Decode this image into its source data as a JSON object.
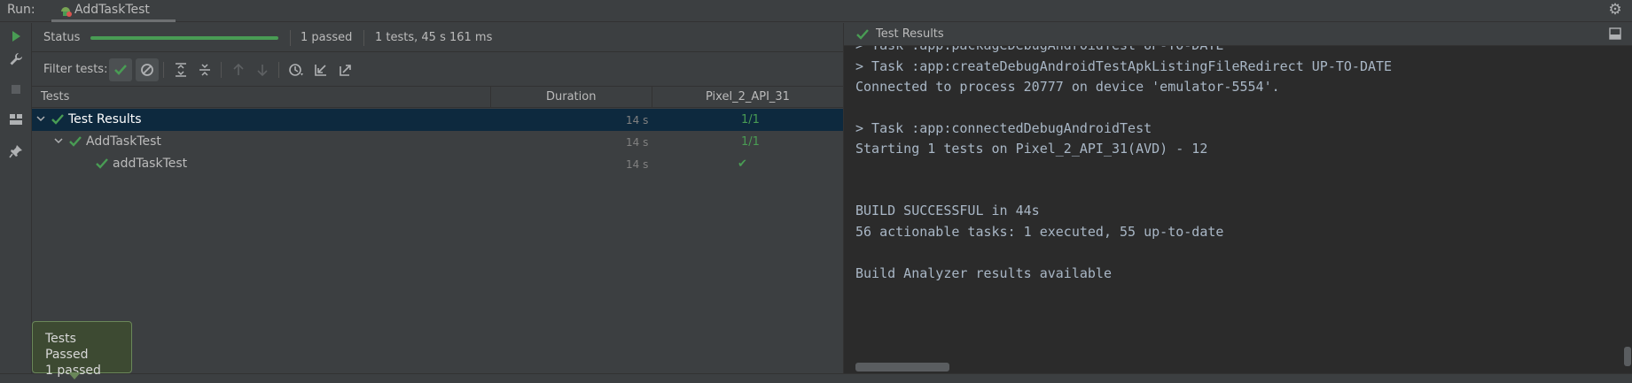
{
  "run_bar": {
    "label": "Run:",
    "tab_label": "AddTaskTest",
    "tab_icon": "android-test-icon",
    "settings_icon": "gear-icon"
  },
  "tool_strip": {
    "icons": [
      "run-icon",
      "wrench-icon",
      "stop-icon",
      "layout-icon",
      "pin-icon"
    ]
  },
  "status": {
    "label": "Status",
    "progress_fraction": 1.0,
    "passed_text": "1 passed",
    "summary_text": "1 tests, 45 s 161 ms"
  },
  "filter": {
    "label": "Filter tests:",
    "buttons": [
      "show-passed-icon",
      "show-ignored-icon",
      "expand-all-icon",
      "collapse-all-icon",
      "previous-failed-icon",
      "next-failed-icon",
      "history-icon",
      "import-tests-icon",
      "export-tests-icon"
    ]
  },
  "tree": {
    "columns": [
      "Tests",
      "Duration",
      "Pixel_2_API_31"
    ],
    "rows": [
      {
        "name": "Test Results",
        "duration": "14 s",
        "result": "1/1",
        "level": 0,
        "expanded": true,
        "selected": true
      },
      {
        "name": "AddTaskTest",
        "duration": "14 s",
        "result": "1/1",
        "level": 1,
        "expanded": true,
        "selected": false
      },
      {
        "name": "addTaskTest",
        "duration": "14 s",
        "result": "✔",
        "level": 2,
        "expanded": false,
        "selected": false
      }
    ]
  },
  "right_panel": {
    "title": "Test Results",
    "console_lines": [
      "> Task :app:packageDebugAndroidTest UP-TO-DATE",
      "> Task :app:createDebugAndroidTestApkListingFileRedirect UP-TO-DATE",
      "Connected to process 20777 on device 'emulator-5554'.",
      "",
      "> Task :app:connectedDebugAndroidTest",
      "Starting 1 tests on Pixel_2_API_31(AVD) - 12",
      "",
      "",
      "BUILD SUCCESSFUL in 44s",
      "56 actionable tasks: 1 executed, 55 up-to-date",
      "",
      "Build Analyzer results available"
    ]
  },
  "tooltip": {
    "title": "Tests Passed",
    "subtitle": "1 passed"
  },
  "colors": {
    "success": "#499c54",
    "selection": "#0d293e",
    "panel": "#3c3f41",
    "console_bg": "#2b2b2b"
  }
}
